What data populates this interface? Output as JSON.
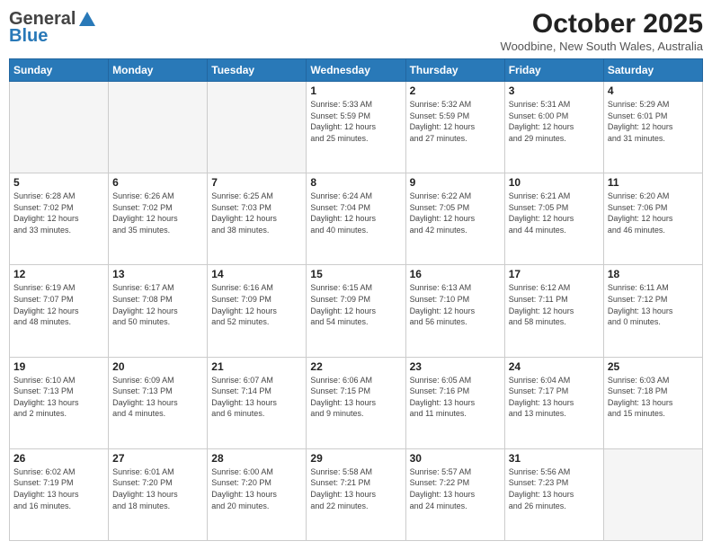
{
  "logo": {
    "general": "General",
    "blue": "Blue"
  },
  "title": "October 2025",
  "location": "Woodbine, New South Wales, Australia",
  "days_header": [
    "Sunday",
    "Monday",
    "Tuesday",
    "Wednesday",
    "Thursday",
    "Friday",
    "Saturday"
  ],
  "weeks": [
    [
      {
        "day": "",
        "info": ""
      },
      {
        "day": "",
        "info": ""
      },
      {
        "day": "",
        "info": ""
      },
      {
        "day": "1",
        "info": "Sunrise: 5:33 AM\nSunset: 5:59 PM\nDaylight: 12 hours\nand 25 minutes."
      },
      {
        "day": "2",
        "info": "Sunrise: 5:32 AM\nSunset: 5:59 PM\nDaylight: 12 hours\nand 27 minutes."
      },
      {
        "day": "3",
        "info": "Sunrise: 5:31 AM\nSunset: 6:00 PM\nDaylight: 12 hours\nand 29 minutes."
      },
      {
        "day": "4",
        "info": "Sunrise: 5:29 AM\nSunset: 6:01 PM\nDaylight: 12 hours\nand 31 minutes."
      }
    ],
    [
      {
        "day": "5",
        "info": "Sunrise: 6:28 AM\nSunset: 7:02 PM\nDaylight: 12 hours\nand 33 minutes."
      },
      {
        "day": "6",
        "info": "Sunrise: 6:26 AM\nSunset: 7:02 PM\nDaylight: 12 hours\nand 35 minutes."
      },
      {
        "day": "7",
        "info": "Sunrise: 6:25 AM\nSunset: 7:03 PM\nDaylight: 12 hours\nand 38 minutes."
      },
      {
        "day": "8",
        "info": "Sunrise: 6:24 AM\nSunset: 7:04 PM\nDaylight: 12 hours\nand 40 minutes."
      },
      {
        "day": "9",
        "info": "Sunrise: 6:22 AM\nSunset: 7:05 PM\nDaylight: 12 hours\nand 42 minutes."
      },
      {
        "day": "10",
        "info": "Sunrise: 6:21 AM\nSunset: 7:05 PM\nDaylight: 12 hours\nand 44 minutes."
      },
      {
        "day": "11",
        "info": "Sunrise: 6:20 AM\nSunset: 7:06 PM\nDaylight: 12 hours\nand 46 minutes."
      }
    ],
    [
      {
        "day": "12",
        "info": "Sunrise: 6:19 AM\nSunset: 7:07 PM\nDaylight: 12 hours\nand 48 minutes."
      },
      {
        "day": "13",
        "info": "Sunrise: 6:17 AM\nSunset: 7:08 PM\nDaylight: 12 hours\nand 50 minutes."
      },
      {
        "day": "14",
        "info": "Sunrise: 6:16 AM\nSunset: 7:09 PM\nDaylight: 12 hours\nand 52 minutes."
      },
      {
        "day": "15",
        "info": "Sunrise: 6:15 AM\nSunset: 7:09 PM\nDaylight: 12 hours\nand 54 minutes."
      },
      {
        "day": "16",
        "info": "Sunrise: 6:13 AM\nSunset: 7:10 PM\nDaylight: 12 hours\nand 56 minutes."
      },
      {
        "day": "17",
        "info": "Sunrise: 6:12 AM\nSunset: 7:11 PM\nDaylight: 12 hours\nand 58 minutes."
      },
      {
        "day": "18",
        "info": "Sunrise: 6:11 AM\nSunset: 7:12 PM\nDaylight: 13 hours\nand 0 minutes."
      }
    ],
    [
      {
        "day": "19",
        "info": "Sunrise: 6:10 AM\nSunset: 7:13 PM\nDaylight: 13 hours\nand 2 minutes."
      },
      {
        "day": "20",
        "info": "Sunrise: 6:09 AM\nSunset: 7:13 PM\nDaylight: 13 hours\nand 4 minutes."
      },
      {
        "day": "21",
        "info": "Sunrise: 6:07 AM\nSunset: 7:14 PM\nDaylight: 13 hours\nand 6 minutes."
      },
      {
        "day": "22",
        "info": "Sunrise: 6:06 AM\nSunset: 7:15 PM\nDaylight: 13 hours\nand 9 minutes."
      },
      {
        "day": "23",
        "info": "Sunrise: 6:05 AM\nSunset: 7:16 PM\nDaylight: 13 hours\nand 11 minutes."
      },
      {
        "day": "24",
        "info": "Sunrise: 6:04 AM\nSunset: 7:17 PM\nDaylight: 13 hours\nand 13 minutes."
      },
      {
        "day": "25",
        "info": "Sunrise: 6:03 AM\nSunset: 7:18 PM\nDaylight: 13 hours\nand 15 minutes."
      }
    ],
    [
      {
        "day": "26",
        "info": "Sunrise: 6:02 AM\nSunset: 7:19 PM\nDaylight: 13 hours\nand 16 minutes."
      },
      {
        "day": "27",
        "info": "Sunrise: 6:01 AM\nSunset: 7:20 PM\nDaylight: 13 hours\nand 18 minutes."
      },
      {
        "day": "28",
        "info": "Sunrise: 6:00 AM\nSunset: 7:20 PM\nDaylight: 13 hours\nand 20 minutes."
      },
      {
        "day": "29",
        "info": "Sunrise: 5:58 AM\nSunset: 7:21 PM\nDaylight: 13 hours\nand 22 minutes."
      },
      {
        "day": "30",
        "info": "Sunrise: 5:57 AM\nSunset: 7:22 PM\nDaylight: 13 hours\nand 24 minutes."
      },
      {
        "day": "31",
        "info": "Sunrise: 5:56 AM\nSunset: 7:23 PM\nDaylight: 13 hours\nand 26 minutes."
      },
      {
        "day": "",
        "info": ""
      }
    ]
  ]
}
